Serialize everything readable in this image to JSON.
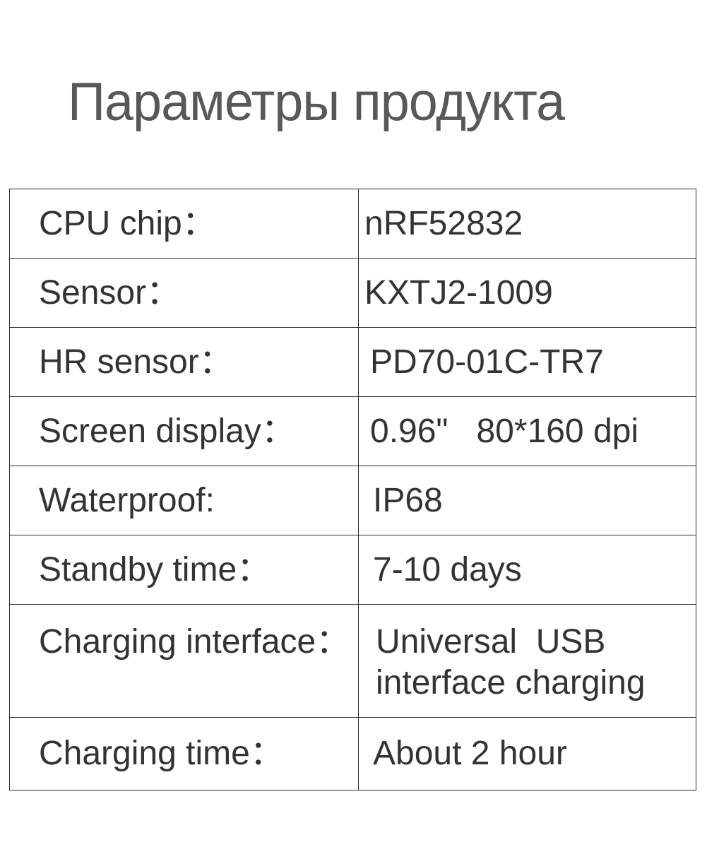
{
  "title": "Параметры продукта",
  "specs": [
    {
      "label": "CPU chip：",
      "value": "nRF52832"
    },
    {
      "label": "Sensor：",
      "value": "KXTJ2-1009"
    },
    {
      "label": "HR sensor：",
      "value": "PD70-01C-TR7"
    },
    {
      "label": "Screen display：",
      "value": "0.96\"   80*160 dpi"
    },
    {
      "label": "Waterproof:",
      "value": "IP68"
    },
    {
      "label": "Standby time：",
      "value": "7-10 days"
    },
    {
      "label": "Charging interface：",
      "value": "Universal  USB",
      "value_line2": "interface charging"
    },
    {
      "label": "Charging time：",
      "value": "About 2 hour"
    }
  ]
}
